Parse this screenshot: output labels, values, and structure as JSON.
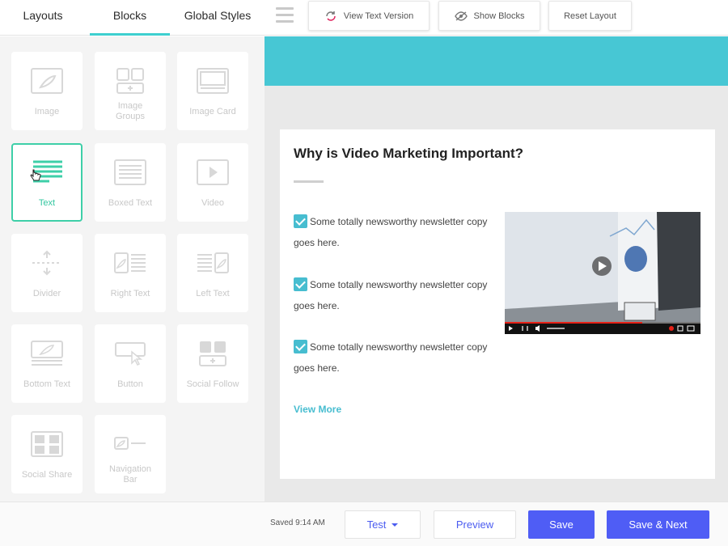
{
  "topbar": {
    "tabs": [
      {
        "label": "Layouts"
      },
      {
        "label": "Blocks",
        "active": true
      },
      {
        "label": "Global Styles"
      }
    ],
    "buttons": {
      "view_text": "View Text Version",
      "show_blocks": "Show Blocks",
      "reset_layout": "Reset Layout"
    }
  },
  "sidebar": {
    "blocks": [
      {
        "label": "Image",
        "icon": "image-icon"
      },
      {
        "label": "Image Groups",
        "icon": "image-groups-icon"
      },
      {
        "label": "Image Card",
        "icon": "image-card-icon"
      },
      {
        "label": "Text",
        "icon": "text-icon",
        "selected": true
      },
      {
        "label": "Boxed Text",
        "icon": "boxed-text-icon"
      },
      {
        "label": "Video",
        "icon": "video-icon"
      },
      {
        "label": "Divider",
        "icon": "divider-icon"
      },
      {
        "label": "Right Text",
        "icon": "right-text-icon"
      },
      {
        "label": "Left Text",
        "icon": "left-text-icon"
      },
      {
        "label": "Bottom Text",
        "icon": "bottom-text-icon"
      },
      {
        "label": "Button",
        "icon": "button-icon"
      },
      {
        "label": "Social Follow",
        "icon": "social-follow-icon"
      },
      {
        "label": "Social Share",
        "icon": "social-share-icon"
      },
      {
        "label": "Navigation Bar",
        "icon": "navigation-bar-icon"
      }
    ]
  },
  "canvas": {
    "heading": "Why is Video Marketing Important?",
    "items": [
      "Some totally newsworthy newsletter copy goes here.",
      "Some totally newsworthy newsletter copy goes here.",
      "Some totally newsworthy newsletter copy goes here."
    ],
    "view_more": "View More"
  },
  "bottombar": {
    "saved": "Saved 9:14 AM",
    "test": "Test",
    "preview": "Preview",
    "save": "Save",
    "save_next": "Save & Next"
  },
  "colors": {
    "accent_teal": "#47c7d4",
    "selected_green": "#3ecfa8",
    "primary_blue": "#4f5df5"
  }
}
